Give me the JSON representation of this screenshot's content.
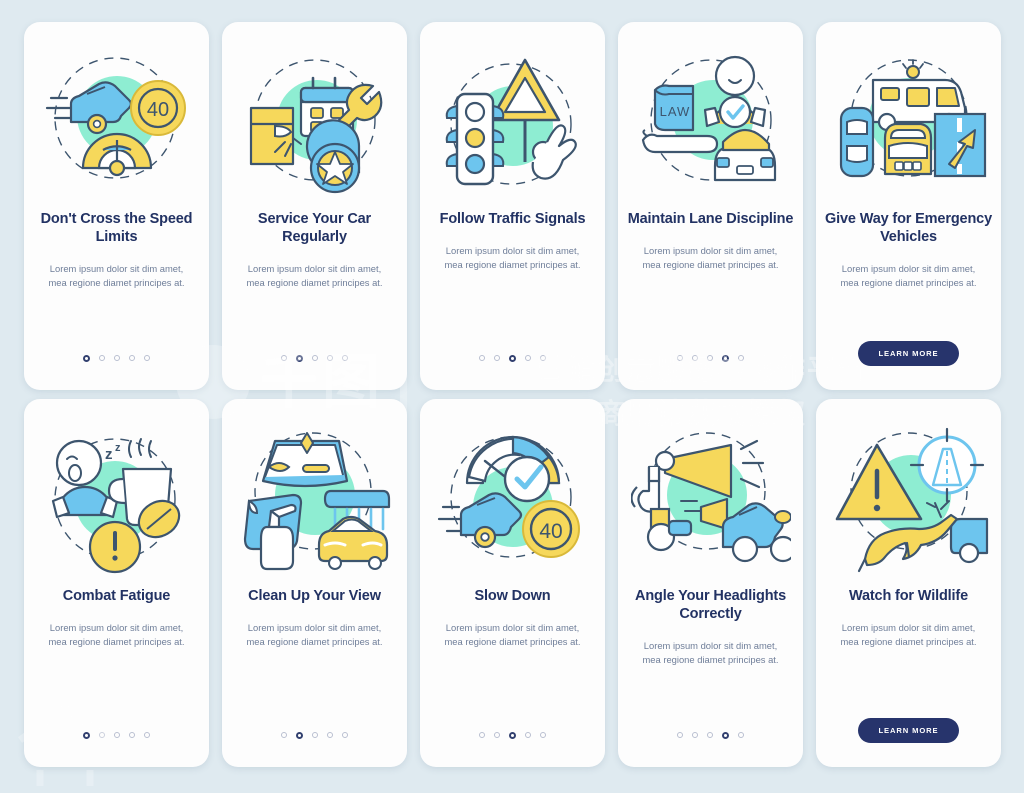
{
  "background_color": "#dfeaf0",
  "palette": {
    "card": "#fdfdfd",
    "title": "#223263",
    "body_text": "#6f7e99",
    "accent_navy": "#27346c",
    "accent_blue": "#6dc5ee",
    "accent_yellow": "#f6d85b",
    "accent_mint": "#8eedd2",
    "stroke": "#3d556e",
    "dot_inactive": "#b9bfd0",
    "dot_active": "#32406f"
  },
  "watermark": {
    "logo_text": "千图",
    "line1": "营销创意服务与协作平台",
    "line2": "商用请获取授权"
  },
  "common": {
    "body_text": "Lorem ipsum dolor sit dim amet, mea regione diamet principes at.",
    "learn_more_label": "LEARN MORE",
    "dot_count": 5
  },
  "cards": [
    {
      "id": "dont-cross-speed-limits",
      "title": "Don't Cross the Speed Limits",
      "body": "Lorem ipsum dolor sit dim amet, mea regione diamet principes at.",
      "illustration": "speeding-car-speedometer-40-sign",
      "active_dot": 1,
      "dot_count": 5,
      "has_button": false,
      "button_label": ""
    },
    {
      "id": "service-your-car-regularly",
      "title": "Service Your Car Regularly",
      "body": "Lorem ipsum dolor sit dim amet, mea regione diamet principes at.",
      "illustration": "calendar-wrench-tire-car",
      "active_dot": 2,
      "dot_count": 5,
      "has_button": false,
      "button_label": ""
    },
    {
      "id": "follow-traffic-signals",
      "title": "Follow Traffic Signals",
      "body": "Lorem ipsum dolor sit dim amet, mea regione diamet principes at.",
      "illustration": "traffic-light-warning-sign-hand",
      "active_dot": 3,
      "dot_count": 5,
      "has_button": false,
      "button_label": ""
    },
    {
      "id": "maintain-lane-discipline",
      "title": "Maintain Lane Discipline",
      "body": "Lorem ipsum dolor sit dim amet, mea regione diamet principes at.",
      "illustration": "law-book-driver-check-car",
      "active_dot": 4,
      "dot_count": 5,
      "has_button": false,
      "button_label": ""
    },
    {
      "id": "give-way-for-emergency-vehicles",
      "title": "Give Way for Emergency Vehicles",
      "body": "Lorem ipsum dolor sit dim amet, mea regione diamet principes at.",
      "illustration": "ambulance-cars-lane-arrow",
      "active_dot": 5,
      "dot_count": 5,
      "has_button": true,
      "button_label": "LEARN MORE"
    },
    {
      "id": "combat-fatigue",
      "title": "Combat Fatigue",
      "body": "Lorem ipsum dolor sit dim amet, mea regione diamet principes at.",
      "illustration": "sleepy-driver-coffee-alert",
      "active_dot": 1,
      "dot_count": 5,
      "has_button": false,
      "button_label": ""
    },
    {
      "id": "clean-up-your-view",
      "title": "Clean Up Your View",
      "body": "Lorem ipsum dolor sit dim amet, mea regione diamet principes at.",
      "illustration": "windshield-spray-car-wash",
      "active_dot": 2,
      "dot_count": 5,
      "has_button": false,
      "button_label": ""
    },
    {
      "id": "slow-down",
      "title": "Slow Down",
      "body": "Lorem ipsum dolor sit dim amet, mea regione diamet principes at.",
      "illustration": "speedometer-check-car-40-sign",
      "active_dot": 3,
      "dot_count": 5,
      "has_button": false,
      "button_label": ""
    },
    {
      "id": "angle-your-headlights-correctly",
      "title": "Angle Your Headlights Correctly",
      "body": "Lorem ipsum dolor sit dim amet, mea regione diamet principes at.",
      "illustration": "wrench-headlight-beam-car",
      "active_dot": 4,
      "dot_count": 5,
      "has_button": false,
      "button_label": ""
    },
    {
      "id": "watch-for-wildlife",
      "title": "Watch for Wildlife",
      "body": "Lorem ipsum dolor sit dim amet, mea regione diamet principes at.",
      "illustration": "warning-triangle-deer-road-sign",
      "active_dot": 5,
      "dot_count": 5,
      "has_button": true,
      "button_label": "LEARN MORE"
    }
  ]
}
